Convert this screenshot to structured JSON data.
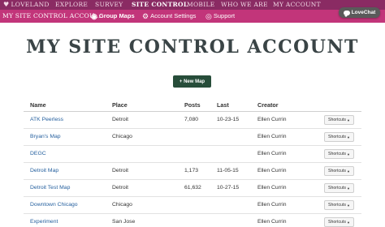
{
  "topnav": {
    "brand": "LOVELAND",
    "items": [
      "EXPLORE",
      "SURVEY",
      "SITE CONTROL",
      "MOBILE",
      "WHO WE ARE",
      "MY ACCOUNT"
    ],
    "active": "SITE CONTROL"
  },
  "subbar": {
    "account_title": "MY SITE CONTROL ACCOU...",
    "group_maps": "Group Maps",
    "account_settings": "Account Settings",
    "support": "Support"
  },
  "lovechat": {
    "label": "LoveChat"
  },
  "page": {
    "title": "MY SITE CONTROL ACCOUNT",
    "new_map": "+ New Map"
  },
  "table": {
    "headers": {
      "name": "Name",
      "place": "Place",
      "posts": "Posts",
      "last": "Last",
      "creator": "Creator"
    },
    "shortcuts_label": "Shortcuts",
    "rows": [
      {
        "name": "ATK Peerless",
        "place": "Detroit",
        "posts": "7,080",
        "last": "10-23-15",
        "creator": "Ellen Currin"
      },
      {
        "name": "Bryan's Map",
        "place": "Chicago",
        "posts": "",
        "last": "",
        "creator": "Ellen Currin"
      },
      {
        "name": "DEGC",
        "place": "",
        "posts": "",
        "last": "",
        "creator": "Ellen Currin"
      },
      {
        "name": "Detroit Map",
        "place": "Detroit",
        "posts": "1,173",
        "last": "11-05-15",
        "creator": "Ellen Currin"
      },
      {
        "name": "Detroit Test Map",
        "place": "Detroit",
        "posts": "61,632",
        "last": "10-27-15",
        "creator": "Ellen Currin"
      },
      {
        "name": "Downtown Chicago",
        "place": "Chicago",
        "posts": "",
        "last": "",
        "creator": "Ellen Currin"
      },
      {
        "name": "Experiment",
        "place": "San Jose",
        "posts": "",
        "last": "",
        "creator": "Ellen Currin"
      }
    ]
  },
  "colors": {
    "topnav": "#8a2b63",
    "subbar": "#c2357a",
    "title": "#3a4446",
    "button": "#274d3a",
    "link": "#245f9e"
  }
}
